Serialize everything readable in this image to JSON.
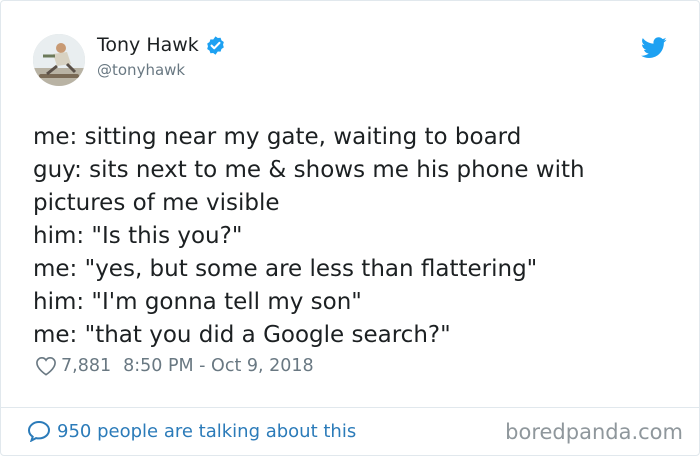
{
  "tweet": {
    "author_name": "Tony Hawk",
    "handle": "@tonyhawk",
    "lines": [
      "me: sitting near my gate, waiting to board",
      "guy: sits next to me & shows me his phone with",
      "pictures of me visible",
      "him: \"Is this you?\"",
      "me: \"yes, but some are less than flattering\"",
      "him: \"I'm gonna tell my son\"",
      "me: \"that you did a Google search?\""
    ],
    "likes": "7,881",
    "timestamp": "8:50 PM - Oct 9, 2018",
    "conversation": "950 people are talking about this"
  },
  "watermark": "boredpanda.com",
  "colors": {
    "text": "#1c2022",
    "secondary": "#697882",
    "link": "#2b7bb9",
    "twitter_blue": "#1da1f2"
  },
  "icons": {
    "verified": "verified-badge-icon",
    "brand": "twitter-bird-icon",
    "like": "heart-outline-icon",
    "reply": "speech-bubble-icon"
  }
}
